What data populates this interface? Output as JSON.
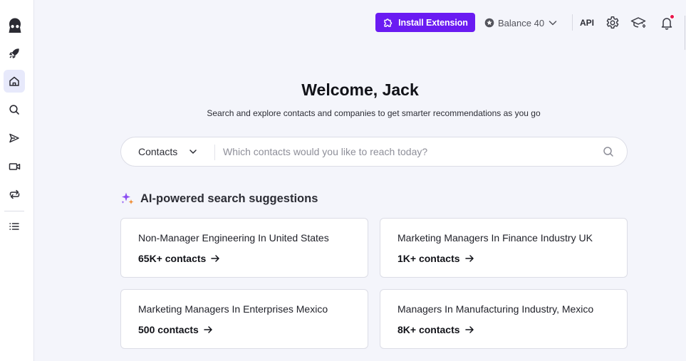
{
  "header": {
    "install_label": "Install Extension",
    "balance_label": "Balance 40",
    "api_label": "API"
  },
  "welcome": {
    "title": "Welcome, Jack",
    "subtitle": "Search and explore contacts and companies to get smarter recommendations as you go"
  },
  "search": {
    "type_label": "Contacts",
    "placeholder": "Which contacts would you like to reach today?",
    "value": ""
  },
  "suggestions": {
    "title": "AI-powered search suggestions",
    "cards": [
      {
        "title": "Non-Manager Engineering In United States",
        "count": "65K+ contacts"
      },
      {
        "title": "Marketing Managers In Finance Industry UK",
        "count": "1K+ contacts"
      },
      {
        "title": "Marketing Managers In Enterprises Mexico",
        "count": "500 contacts"
      },
      {
        "title": "Managers In Manufacturing Industry, Mexico",
        "count": "8K+ contacts"
      }
    ]
  },
  "sidebar": {
    "items": [
      {
        "icon": "rocket-icon"
      },
      {
        "icon": "home-icon",
        "active": true
      },
      {
        "icon": "search-icon"
      },
      {
        "icon": "send-icon"
      },
      {
        "icon": "video-icon"
      },
      {
        "icon": "repeat-icon"
      },
      {
        "icon": "list-icon"
      }
    ]
  },
  "colors": {
    "brand": "#6a1bf2",
    "background": "#f4f5fb",
    "notification": "#e8164c",
    "sparkle_purple": "#8b4ef2",
    "sparkle_orange": "#f0882a"
  }
}
